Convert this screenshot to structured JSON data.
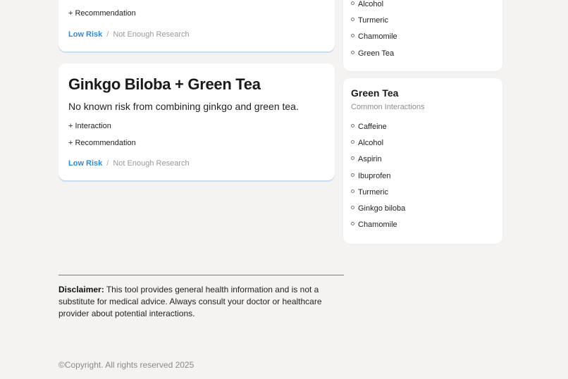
{
  "cards": [
    {
      "title": "",
      "description": "",
      "interaction_label": "",
      "recommendation_label": "+ Recommendation",
      "risk_label": "Low Risk",
      "research_label": "Not Enough Research"
    },
    {
      "title": "Ginkgo Biloba + Green Tea",
      "description": "No known risk from combining ginkgo and green tea.",
      "interaction_label": "+ Interaction",
      "recommendation_label": "+ Recommendation",
      "risk_label": "Low Risk",
      "research_label": "Not Enough Research"
    }
  ],
  "separator": "/",
  "sidebar_top": {
    "items": [
      "Alcohol",
      "Turmeric",
      "Chamomile",
      "Green Tea"
    ]
  },
  "sidebar_green_tea": {
    "title": "Green Tea",
    "subtitle": "Common Interactions",
    "items": [
      "Caffeine",
      "Alcohol",
      "Aspirin",
      "Ibuprofen",
      "Turmeric",
      "Ginkgo biloba",
      "Chamomile"
    ]
  },
  "disclaimer": {
    "label": "Disclaimer:",
    "text": " This tool provides general health information and is not a substitute for medical advice. Always consult your doctor or healthcare provider about potential interactions."
  },
  "copyright": "©Copyright. All rights reserved 2025",
  "colors": {
    "background": "#f4f3f1",
    "risk_low": "#2b8be0",
    "card_accent": "#c9dcf5"
  }
}
